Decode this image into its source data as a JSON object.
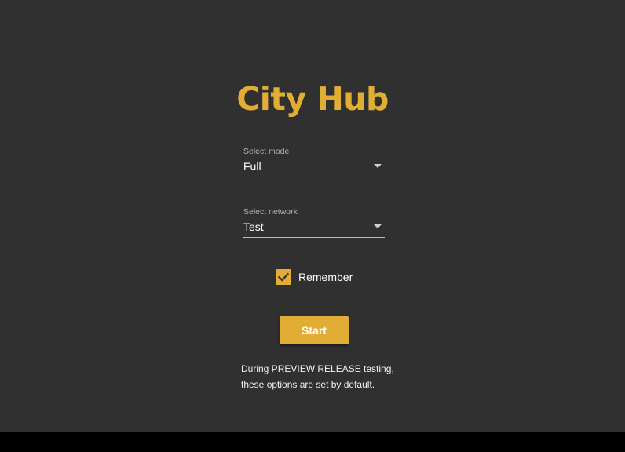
{
  "app": {
    "title": "City Hub",
    "accent_color": "#e2ad34",
    "background_color": "#303030"
  },
  "mode_select": {
    "label": "Select mode",
    "value": "Full",
    "icon": "dropdown-arrow-icon"
  },
  "network_select": {
    "label": "Select network",
    "value": "Test",
    "icon": "dropdown-arrow-icon"
  },
  "remember": {
    "label": "Remember",
    "checked": true,
    "icon": "checkmark-icon"
  },
  "start_button": {
    "label": "Start"
  },
  "note": {
    "line1": "During PREVIEW RELEASE testing,",
    "line2": "these options are set by default."
  }
}
